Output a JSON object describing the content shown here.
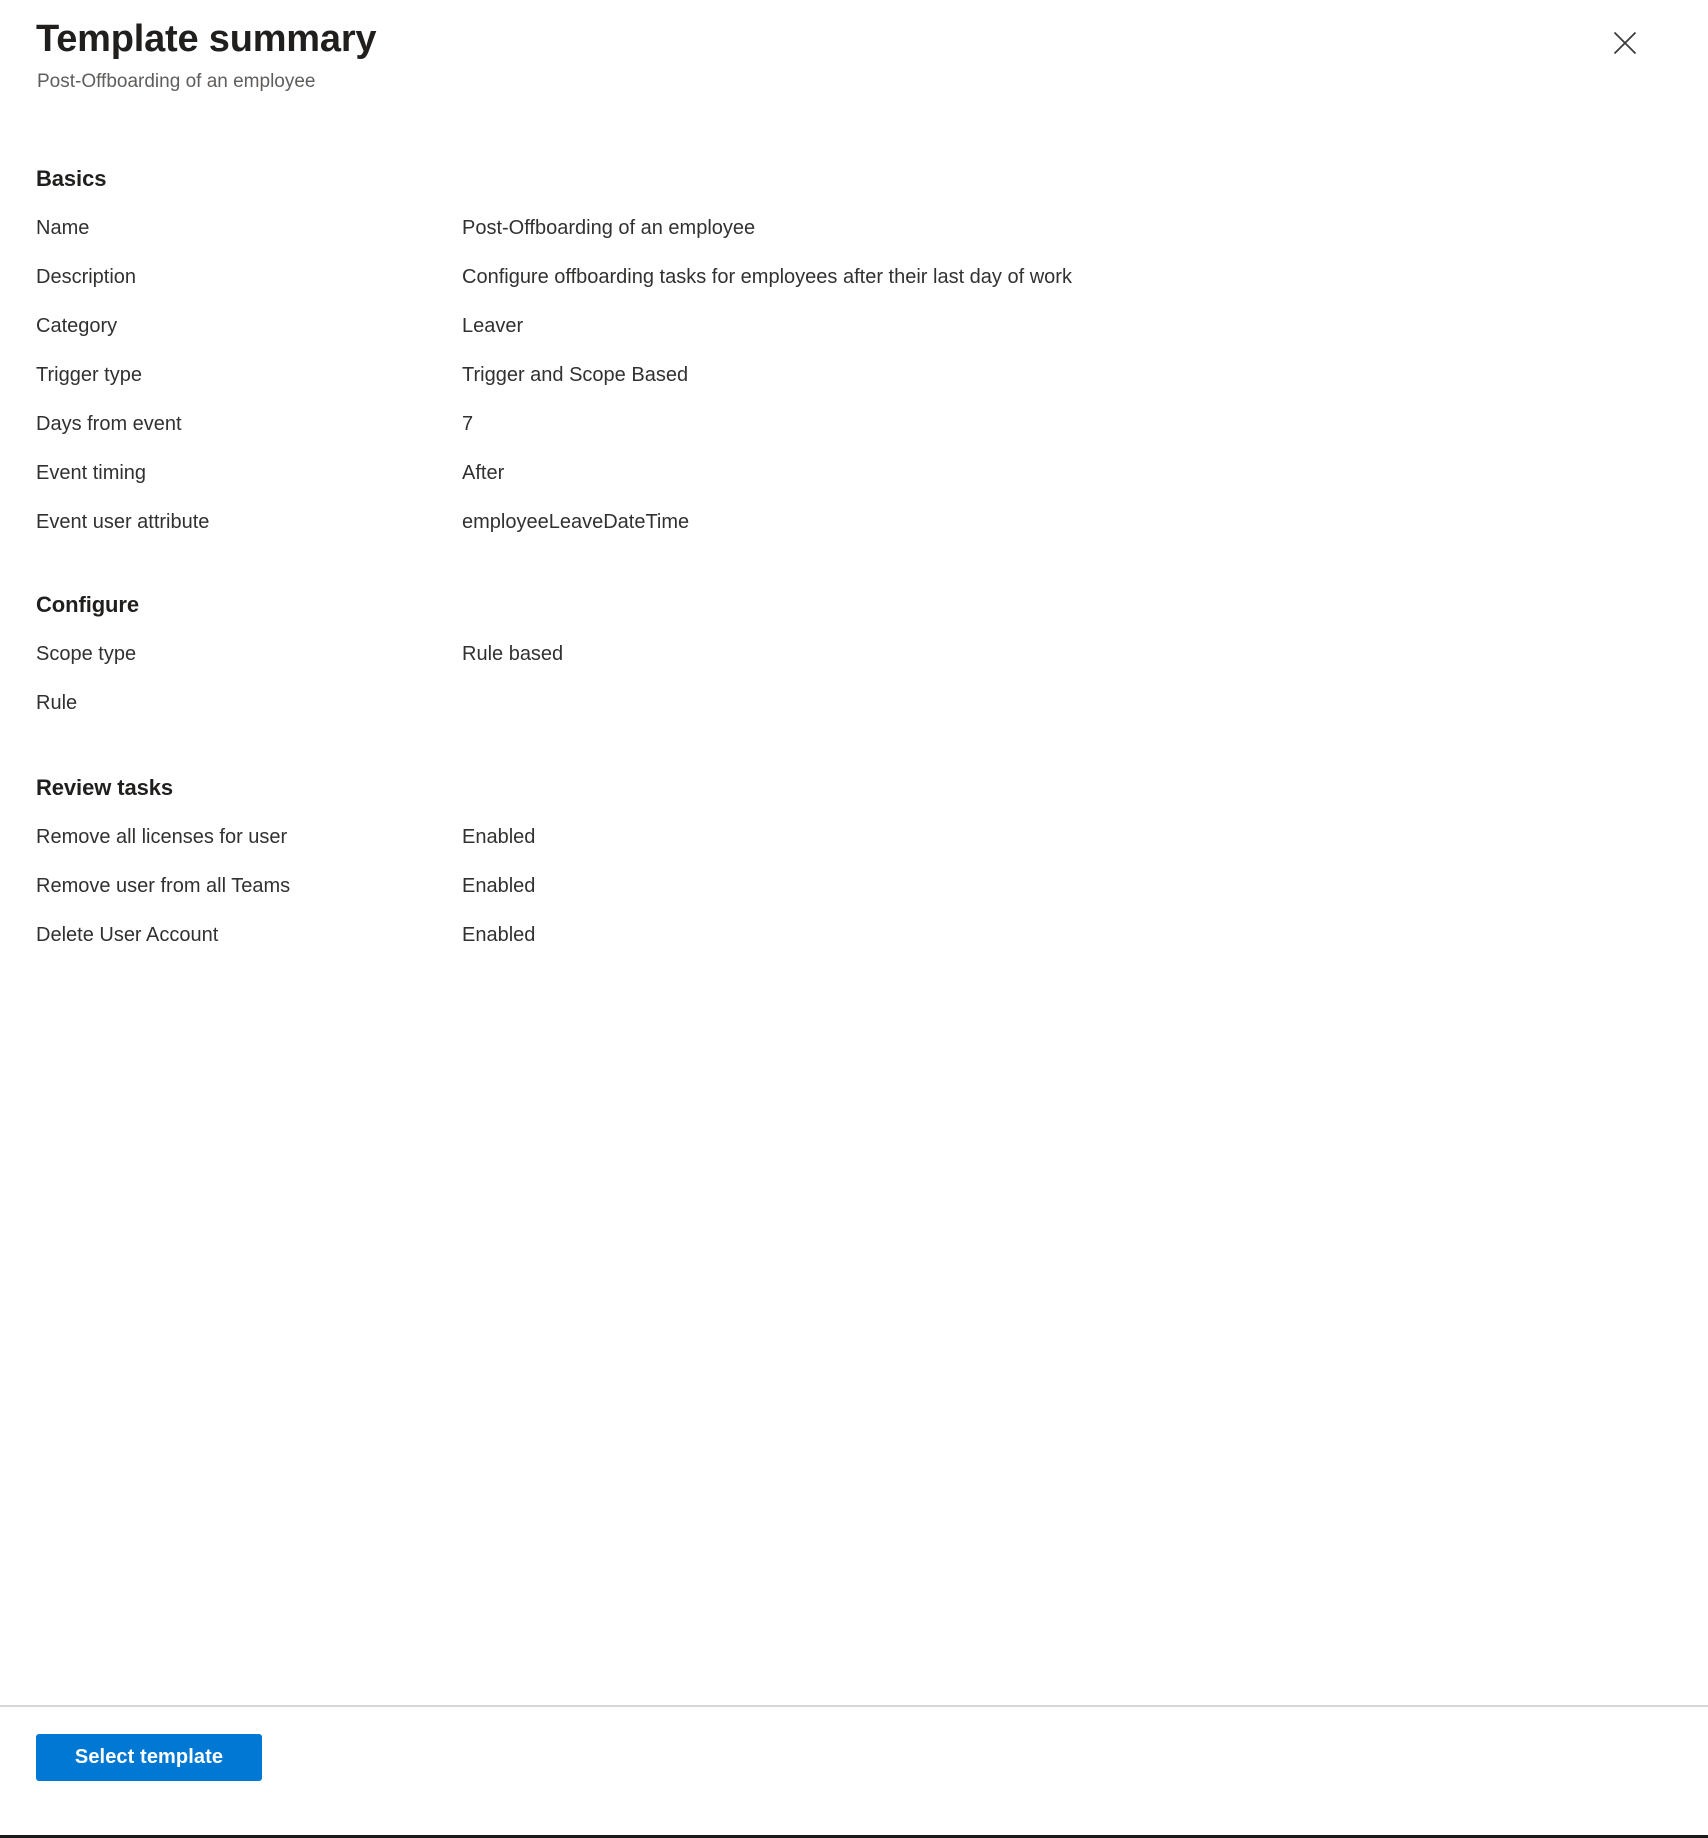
{
  "header": {
    "title": "Template summary",
    "subtitle": "Post-Offboarding of an employee",
    "close_icon": "close-icon",
    "close_label": "Close"
  },
  "colors": {
    "accent": "#0078d4",
    "text": "#323130",
    "title": "#201f1e",
    "subtitle": "#605e5c",
    "divider": "#d6d6d6",
    "button_text": "#ffffff"
  },
  "sections": [
    {
      "id": "basics",
      "heading": "Basics",
      "rows": [
        {
          "label": "Name",
          "value": "Post-Offboarding of an employee"
        },
        {
          "label": "Description",
          "value": "Configure offboarding tasks for employees after their last day of work"
        },
        {
          "label": "Category",
          "value": "Leaver"
        },
        {
          "label": "Trigger type",
          "value": "Trigger and Scope Based"
        },
        {
          "label": "Days from event",
          "value": "7"
        },
        {
          "label": "Event timing",
          "value": "After"
        },
        {
          "label": "Event user attribute",
          "value": "employeeLeaveDateTime"
        }
      ]
    },
    {
      "id": "configure",
      "heading": "Configure",
      "rows": [
        {
          "label": "Scope type",
          "value": "Rule based"
        },
        {
          "label": "Rule",
          "value": ""
        }
      ]
    },
    {
      "id": "review-tasks",
      "heading": "Review tasks",
      "rows": [
        {
          "label": "Remove all licenses for user",
          "value": "Enabled"
        },
        {
          "label": "Remove user from all Teams",
          "value": "Enabled"
        },
        {
          "label": "Delete User Account",
          "value": "Enabled"
        }
      ]
    }
  ],
  "footer": {
    "primary_button_label": "Select template"
  }
}
